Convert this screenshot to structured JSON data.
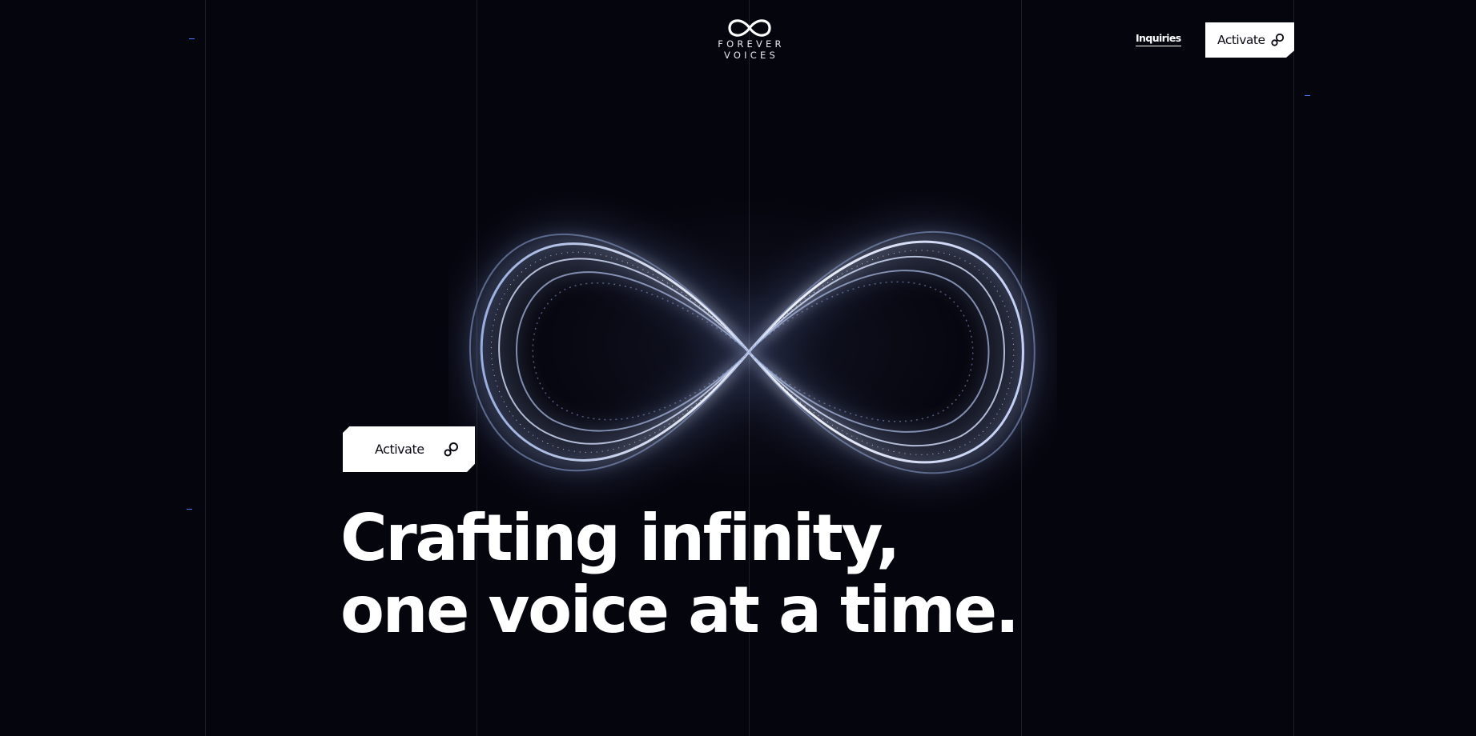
{
  "header": {
    "logo": {
      "icon": "infinity-icon",
      "line1": "FOREVER",
      "line2": "VOICES"
    },
    "nav": {
      "inquiries_label": "Inquiries"
    },
    "activate_button": {
      "label": "Activate",
      "icon": "link-icon"
    }
  },
  "hero": {
    "artwork": "glowing-infinity-illustration",
    "activate_button": {
      "label": "Activate",
      "icon": "link-icon"
    },
    "headline_line1": "Crafting infinity,",
    "headline_line2": "one voice at a time."
  },
  "colors": {
    "background": "#05050d",
    "foreground": "#ffffff",
    "accent_tick": "#4a78ff",
    "glow": "#bcd0ff"
  }
}
